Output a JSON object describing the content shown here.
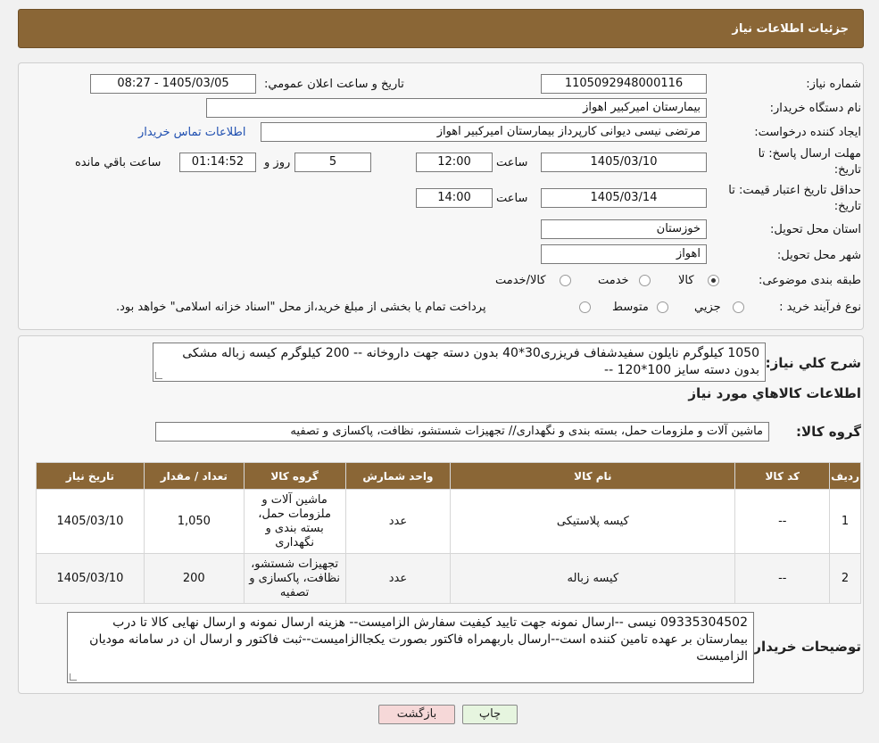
{
  "header": {
    "title": "جزئیات اطلاعات نیاز"
  },
  "form": {
    "need_number_label": "شماره نیاز:",
    "need_number": "1105092948000116",
    "announce_label": "تاریخ و ساعت اعلان عمومي:",
    "announce_value": "1405/03/05 - 08:27",
    "buyer_label": "نام دستگاه خريدار:",
    "buyer_value": "بیمارستان امیرکبیر اهواز",
    "creator_label": "ايجاد کننده درخواست:",
    "creator_value": "مرتضی نیسی دیوانی کارپرداز بیمارستان امیرکبیر اهواز",
    "contact_link": "اطلاعات تماس خريدار",
    "deadline_label_1": "مهلت ارسال پاسخ: تا",
    "deadline_label_2": "تاريخ:",
    "deadline_date": "1405/03/10",
    "time_label": "ساعت",
    "deadline_time": "12:00",
    "days_value": "5",
    "days_label": "روز و",
    "remaining_value": "01:14:52",
    "remaining_label": "ساعت باقي مانده",
    "validity_label_1": "حداقل تاريخ اعتبار قيمت: تا",
    "validity_label_2": "تاريخ:",
    "validity_date": "1405/03/14",
    "validity_time": "14:00",
    "province_label": "استان محل تحويل:",
    "province_value": "خوزستان",
    "city_label": "شهر محل تحويل:",
    "city_value": "اهواز",
    "category_label": "طبقه بندی موضوعی:",
    "category_options": [
      "کالا",
      "خدمت",
      "کالا/خدمت"
    ],
    "process_label": "نوع فرآيند خريد :",
    "process_options": [
      "جزیي",
      "متوسط"
    ],
    "process_note": "پرداخت تمام یا بخشی از مبلغ خرید،از محل \"اسناد خزانه اسلامی\" خواهد بود."
  },
  "summary": {
    "label": "شرح کلي نياز:",
    "text": "1050 کیلوگرم نایلون سفیدشفاف فریزری30*40 بدون دسته جهت داروخانه -- 200 کیلوگرم کیسه زباله مشکی بدون دسته سایز 100*120 --"
  },
  "goods": {
    "title": "اطلاعات کالاهاي مورد نياز",
    "group_label": "گروه کالا:",
    "group_value": "ماشین آلات و ملزومات حمل، بسته بندی و نگهداری// تجهیزات شستشو، نظافت، پاکسازی و تصفیه",
    "columns": [
      "رديف",
      "کد کالا",
      "نام کالا",
      "واحد شمارش",
      "گروه کالا",
      "تعداد / مقدار",
      "تاريخ نياز"
    ],
    "rows": [
      {
        "index": "1",
        "code": "--",
        "name": "کیسه پلاستیکی",
        "unit": "عدد",
        "group": "ماشین آلات و ملزومات حمل، بسته بندی و نگهداری",
        "qty": "1,050",
        "date": "1405/03/10"
      },
      {
        "index": "2",
        "code": "--",
        "name": "کیسه زباله",
        "unit": "عدد",
        "group": "تجهیزات شستشو، نظافت، پاکسازی و تصفیه",
        "qty": "200",
        "date": "1405/03/10"
      }
    ]
  },
  "buyer_notes": {
    "label": "توضيحات خريدار:",
    "text": "09335304502 نیسی --ارسال نمونه جهت تایید کیفیت سفارش الزامیست-- هزینه ارسال نمونه و ارسال نهایی کالا تا درب بیمارستان بر عهده تامین کننده است--ارسال باربهمراه فاکتور بصورت یکجاالزامیست--ثبت فاکتور و ارسال ان در سامانه مودیان الزامیست"
  },
  "buttons": {
    "print": "چاپ",
    "back": "بازگشت"
  },
  "colors": {
    "header_bg": "#8a6636",
    "link": "#1f4fb0",
    "back_btn": "#f6d8d8",
    "print_btn": "#e6f5df"
  }
}
